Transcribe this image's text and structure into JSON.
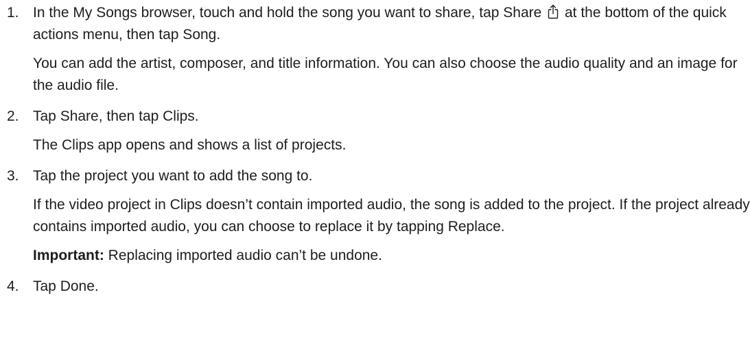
{
  "steps": [
    {
      "number": "1.",
      "line_before_icon": "In the My Songs browser, touch and hold the song you want to share, tap Share",
      "icon": "share-icon",
      "line_after_icon": "at the bottom of the quick actions menu, then tap Song.",
      "note": "You can add the artist, composer, and title information. You can also choose the audio quality and an image for the audio file."
    },
    {
      "number": "2.",
      "line": "Tap Share, then tap Clips.",
      "note": "The Clips app opens and shows a list of projects."
    },
    {
      "number": "3.",
      "line": "Tap the project you want to add the song to.",
      "note": "If the video project in Clips doesn’t contain imported audio, the song is added to the project. If the project already contains imported audio, you can choose to replace it by tapping Replace.",
      "important_label": "Important:",
      "important_text": "Replacing imported audio can’t be undone."
    },
    {
      "number": "4.",
      "line": "Tap Done."
    }
  ]
}
